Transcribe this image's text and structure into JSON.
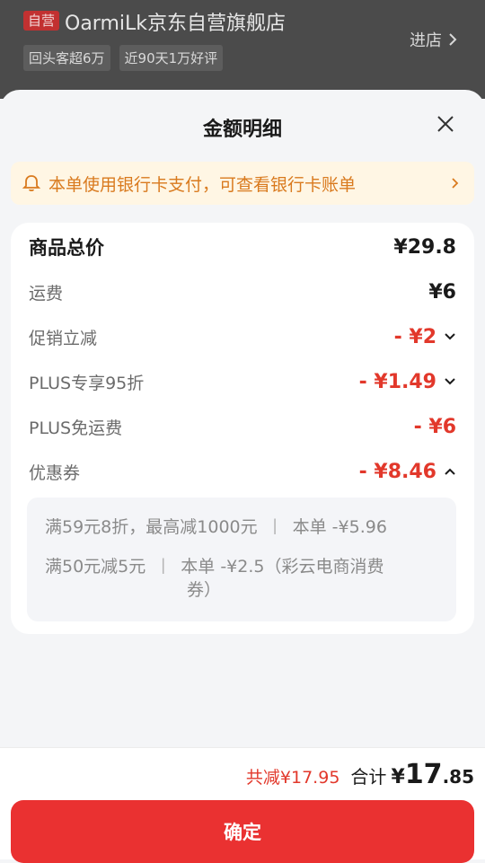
{
  "store": {
    "badge": "自营",
    "name": "OarmiLk京东自营旗舰店",
    "enter_label": "进店",
    "tags": [
      "回头客超6万",
      "近90天1万好评"
    ]
  },
  "sheet": {
    "title": "金额明细",
    "notice": "本单使用银行卡支付，可查看银行卡账单"
  },
  "details": {
    "total_label": "商品总价",
    "total_value": "¥29.8",
    "shipping_label": "运费",
    "shipping_value": "¥6",
    "promo_label": "促销立减",
    "promo_value": "- ¥2",
    "plus95_label": "PLUS专享95折",
    "plus95_value": "- ¥1.49",
    "plusfree_label": "PLUS免运费",
    "plusfree_value": "- ¥6",
    "coupon_label": "优惠券",
    "coupon_value": "- ¥8.46"
  },
  "coupons": [
    {
      "name": "满59元8折，最高减1000元",
      "sep": "丨",
      "detail": "本单 -¥5.96"
    },
    {
      "name": "满50元减5元",
      "sep": "丨",
      "detail": "本单 -¥2.5（彩云电商消费",
      "detail2": "券）"
    }
  ],
  "footer": {
    "saved": "共减¥17.95",
    "sum_label": "合计",
    "sum_yen": "¥",
    "sum_int": "17",
    "sum_dec": ".85",
    "confirm_label": "确定"
  },
  "colors": {
    "accent": "#e2382b",
    "button": "#ea3131",
    "notice_bg": "#fff6e4",
    "notice_text": "#d97a1e"
  }
}
